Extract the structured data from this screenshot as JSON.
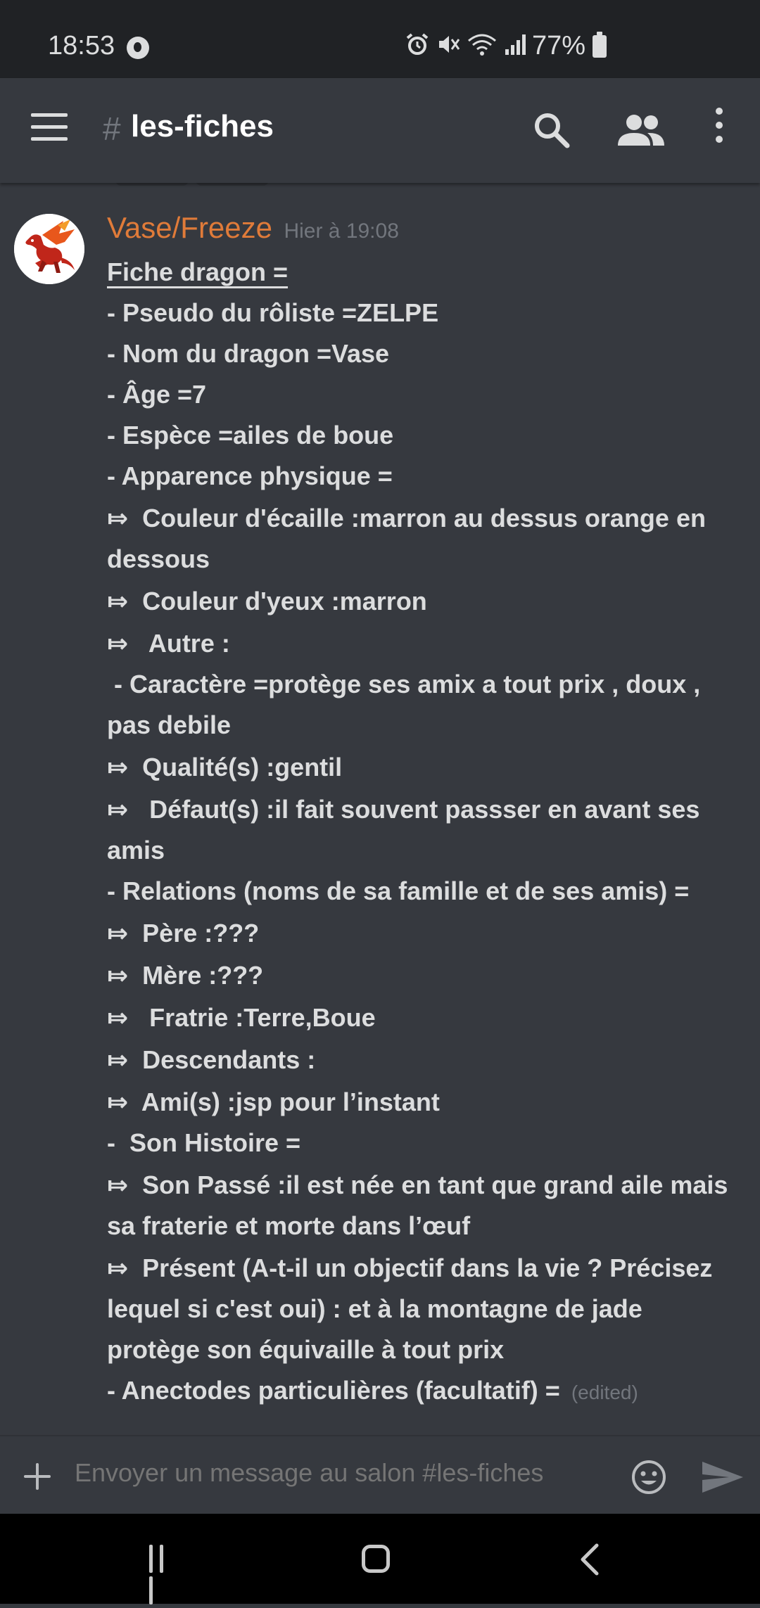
{
  "status_bar": {
    "time": "18:53",
    "battery": "77%"
  },
  "header": {
    "hash": "#",
    "channel": "les-fiches"
  },
  "message": {
    "username": "Vase/Freeze",
    "username_color": "#e07b39",
    "timestamp": "Hier à 19:08",
    "edited": "(edited)",
    "lines": [
      "Fiche dragon =",
      "- Pseudo du rôliste =ZELPE",
      "- Nom du dragon =Vase",
      "- Âge =7",
      "- Espèce =ailes de boue",
      "- Apparence physique =",
      "⤇  Couleur d'écaille :marron au dessus orange en dessous",
      "⤇  Couleur d'yeux :marron",
      "⤇   Autre :",
      " - Caractère =protège ses amix a tout prix , doux , pas debile",
      "⤇  Qualité(s) :gentil",
      "⤇   Défaut(s) :il fait souvent passser en avant ses amis",
      "- Relations (noms de sa famille et de ses amis) =",
      "⤇  Père :???",
      "⤇  Mère :???",
      "⤇   Fratrie :Terre,Boue",
      "⤇  Descendants :",
      "⤇  Ami(s) :jsp pour l’instant",
      "-  Son Histoire =",
      "⤇  Son Passé :il est née en tant que grand aile mais sa fraterie et morte dans l’œuf",
      "⤇  Présent (A-t-il un objectif dans la vie ? Précisez lequel si c'est oui) : et à la montagne de jade protège son équivaille à tout prix",
      "- Anectodes particulières (facultatif) ="
    ]
  },
  "composer": {
    "placeholder": "Envoyer un message au salon #les-fiches"
  },
  "icons": {
    "menu": "menu-icon",
    "search": "search-icon",
    "members": "members-icon",
    "more": "more-vertical-icon",
    "plus": "plus-icon",
    "emoji": "emoji-icon",
    "send": "send-icon"
  }
}
